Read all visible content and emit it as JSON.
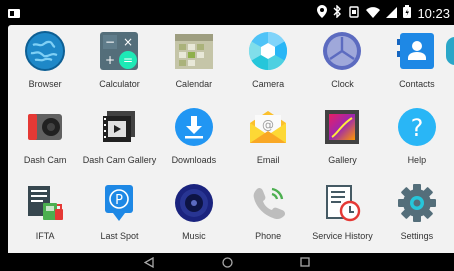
{
  "status": {
    "time": "10:23",
    "icons": [
      "location-icon",
      "bluetooth-icon",
      "vibrate-icon",
      "wifi-icon",
      "signal-icon",
      "battery-icon"
    ]
  },
  "apps": [
    {
      "label": "Browser",
      "icon": "globe-icon"
    },
    {
      "label": "Calculator",
      "icon": "calculator-icon"
    },
    {
      "label": "Calendar",
      "icon": "calendar-icon"
    },
    {
      "label": "Camera",
      "icon": "camera-shutter-icon"
    },
    {
      "label": "Clock",
      "icon": "clock-icon"
    },
    {
      "label": "Contacts",
      "icon": "contacts-icon"
    },
    {
      "label": "Dash Cam",
      "icon": "dash-cam-icon"
    },
    {
      "label": "Dash Cam Gallery",
      "icon": "film-gallery-icon"
    },
    {
      "label": "Downloads",
      "icon": "download-icon"
    },
    {
      "label": "Email",
      "icon": "email-envelope-icon"
    },
    {
      "label": "Gallery",
      "icon": "gallery-icon"
    },
    {
      "label": "Help",
      "icon": "help-icon"
    },
    {
      "label": "IFTA",
      "icon": "fuel-document-icon"
    },
    {
      "label": "Last Spot",
      "icon": "parking-pin-icon"
    },
    {
      "label": "Music",
      "icon": "speaker-icon"
    },
    {
      "label": "Phone",
      "icon": "phone-handset-icon"
    },
    {
      "label": "Service History",
      "icon": "service-history-icon"
    },
    {
      "label": "Settings",
      "icon": "gear-icon"
    }
  ],
  "nav": {
    "back_icon": "back-triangle-icon",
    "home_icon": "home-circle-icon",
    "recents_icon": "recents-square-icon"
  }
}
